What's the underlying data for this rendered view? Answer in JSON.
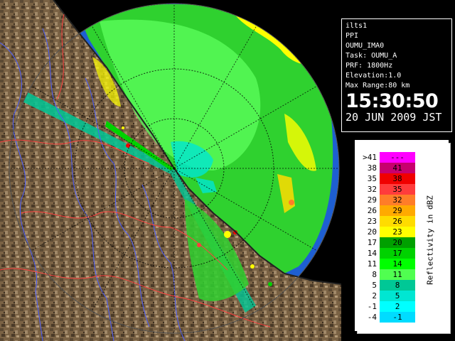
{
  "info": {
    "station": "ilts1",
    "mode": "PPI",
    "site": "OUMU_IMA0",
    "task": "Task: OUMU_A",
    "prf": "PRF: 1800Hz",
    "elevation": "Elevation:1.0",
    "max_range": "Max Range:80 km",
    "time": "15:30:50",
    "date": "20 JUN 2009 JST"
  },
  "legend": {
    "title": "Reflectivity in dBZ",
    "rows": [
      {
        "lo": ">41",
        "hi": "---",
        "color": "#ff00ff"
      },
      {
        "lo": "38",
        "hi": "41",
        "color": "#c8006e"
      },
      {
        "lo": "35",
        "hi": "38",
        "color": "#f00000"
      },
      {
        "lo": "32",
        "hi": "35",
        "color": "#ff3c3c"
      },
      {
        "lo": "29",
        "hi": "32",
        "color": "#ff7d28"
      },
      {
        "lo": "26",
        "hi": "29",
        "color": "#ffaa00"
      },
      {
        "lo": "23",
        "hi": "26",
        "color": "#ffdc00"
      },
      {
        "lo": "20",
        "hi": "23",
        "color": "#ffff00"
      },
      {
        "lo": "17",
        "hi": "20",
        "color": "#00a000"
      },
      {
        "lo": "14",
        "hi": "17",
        "color": "#00d200"
      },
      {
        "lo": "11",
        "hi": "14",
        "color": "#00ff00"
      },
      {
        "lo": "8",
        "hi": "11",
        "color": "#50ff50"
      },
      {
        "lo": "5",
        "hi": "8",
        "color": "#00c896"
      },
      {
        "lo": "2",
        "hi": "5",
        "color": "#00e6d2"
      },
      {
        "lo": "-1",
        "hi": "2",
        "color": "#00ffff"
      },
      {
        "lo": "-4",
        "hi": "-1",
        "color": "#00dcff"
      }
    ]
  },
  "colors": {
    "sea": "#1e5fd2",
    "land": "#7a6244",
    "background": "#000000"
  }
}
